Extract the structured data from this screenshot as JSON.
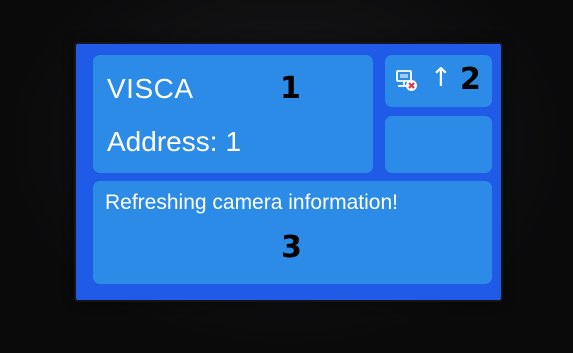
{
  "device": {
    "protocol": "VISCA",
    "address_label": "Address:",
    "address_value": "1",
    "connection_icon": "network-disconnected-icon",
    "arrow_icon": "↑",
    "message": "Refreshing camera information!"
  },
  "callouts": {
    "one": "1",
    "two": "2",
    "three": "3"
  },
  "colors": {
    "screen_background": "#1f5be6",
    "panel_background": "#2c8be6",
    "text": "#ffffff",
    "callout_text": "#000000",
    "error_x": "#e8324a"
  }
}
